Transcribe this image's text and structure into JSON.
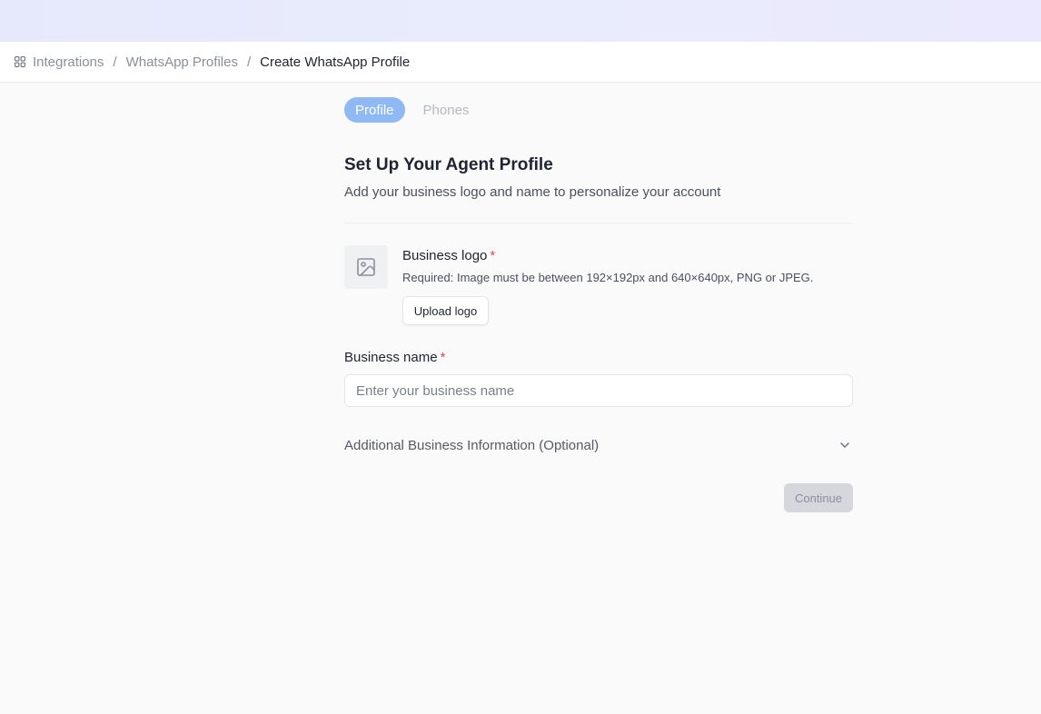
{
  "breadcrumb": {
    "items": [
      "Integrations",
      "WhatsApp Profiles"
    ],
    "separator": "/",
    "current": "Create WhatsApp Profile"
  },
  "tabs": [
    {
      "label": "Profile",
      "active": true
    },
    {
      "label": "Phones",
      "active": false
    }
  ],
  "page": {
    "title": "Set Up Your Agent Profile",
    "subtitle": "Add your business logo and name to personalize your account"
  },
  "logo": {
    "label": "Business logo",
    "required_mark": "*",
    "help": "Required: Image must be between 192×192px and 640×640px, PNG or JPEG.",
    "upload_label": "Upload logo"
  },
  "business_name": {
    "label": "Business name",
    "required_mark": "*",
    "value": "",
    "placeholder": "Enter your business name"
  },
  "additional": {
    "label": "Additional Business Information (Optional)",
    "expanded": false
  },
  "actions": {
    "continue_label": "Continue",
    "continue_disabled": true
  },
  "colors": {
    "accent_tab": "#8fb9f5",
    "required": "#e5484d",
    "disabled_button": "#d5d7dc"
  },
  "icons": {
    "breadcrumb": "grid-icon",
    "logo_placeholder": "image-icon",
    "accordion": "chevron-down-icon"
  }
}
